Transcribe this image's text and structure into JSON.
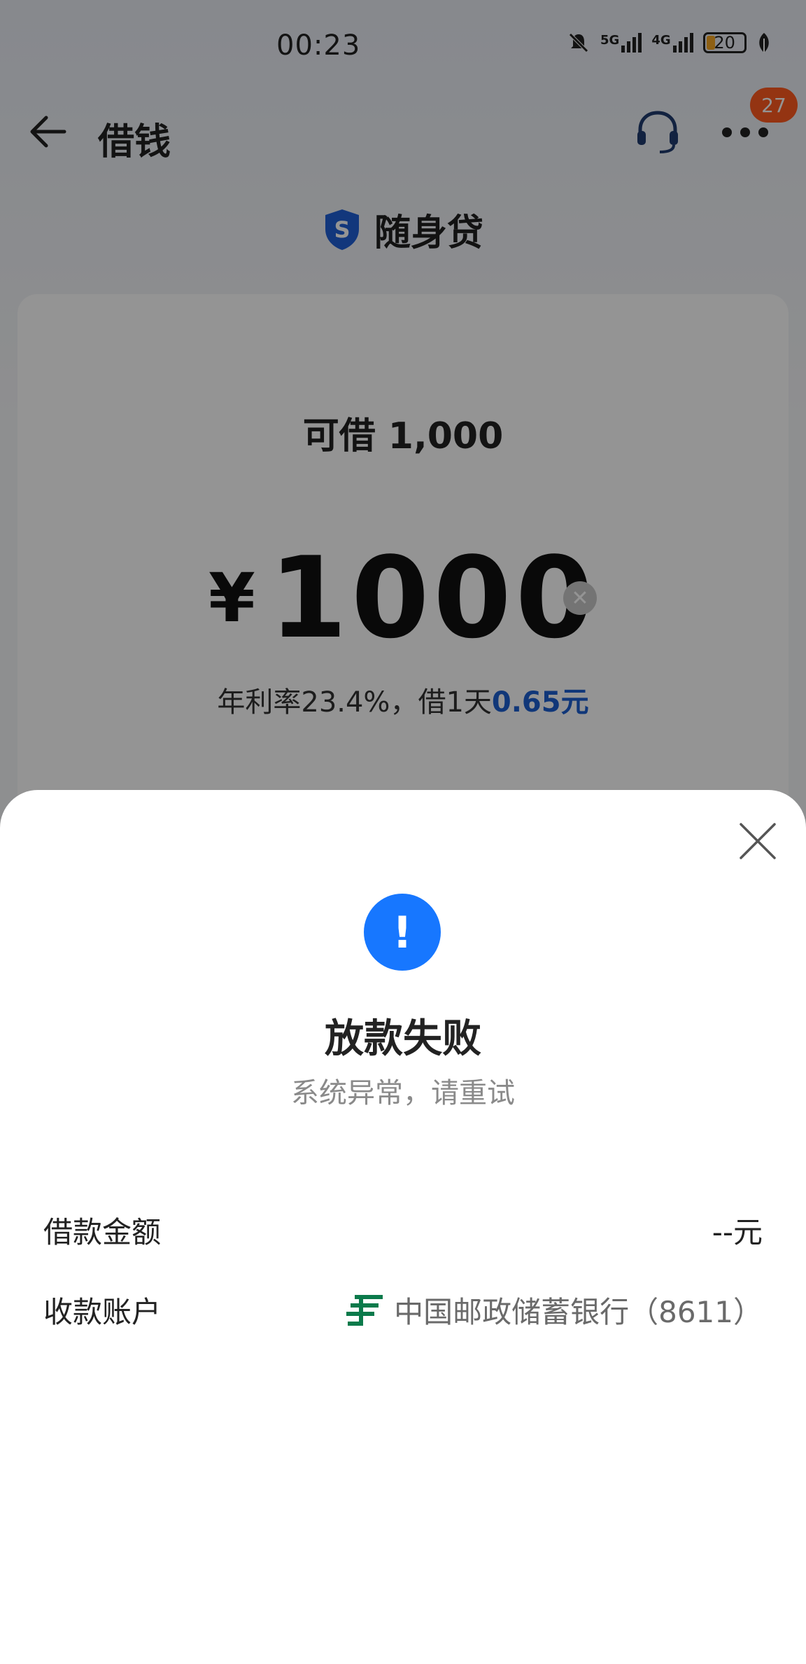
{
  "status_bar": {
    "time": "00:23",
    "network_5g": "5G",
    "network_4g": "4G",
    "battery": "20",
    "icons": [
      "mute-icon",
      "signal-5g-icon",
      "signal-4g-icon",
      "battery-icon",
      "leaf-icon"
    ]
  },
  "header": {
    "title": "借钱",
    "badge": "27",
    "icons": [
      "back-arrow-icon",
      "headset-icon",
      "more-icon"
    ]
  },
  "product": {
    "name": "随身贷",
    "logo_letter": "S"
  },
  "loan": {
    "available_label": "可借 1,000",
    "currency": "¥",
    "amount": "1000",
    "rate_text": "年利率23.4%，借1天",
    "daily_cost": "0.65元"
  },
  "sheet": {
    "alert_mark": "!",
    "title": "放款失败",
    "subtitle": "系统异常，请重试",
    "rows": [
      {
        "label": "借款金额",
        "value": "--元"
      },
      {
        "label": "收款账户",
        "value": "中国邮政储蓄银行（8611）"
      }
    ]
  },
  "colors": {
    "accent": "#1777ff",
    "badge": "#ff5a1f",
    "rate_cost": "#1c5fd1",
    "bank_logo": "#0b7a4b"
  }
}
